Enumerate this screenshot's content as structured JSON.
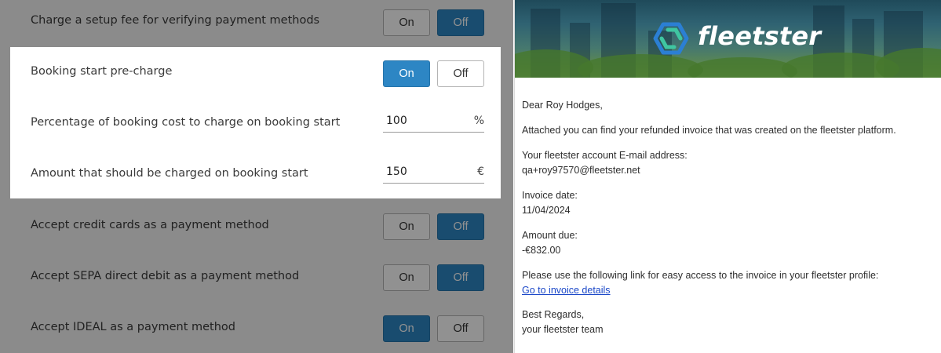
{
  "settings": {
    "on_label": "On",
    "off_label": "Off",
    "rows": [
      {
        "label": "Charge a setup fee for verifying payment methods",
        "state": "off"
      },
      {
        "label": "Booking start pre-charge",
        "state": "on"
      },
      {
        "label": "Percentage of booking cost to charge on booking start",
        "value": "100",
        "unit": "%"
      },
      {
        "label": "Amount that should be charged on booking start",
        "value": "150",
        "unit": "€"
      },
      {
        "label": "Accept credit cards as a payment method",
        "state": "off"
      },
      {
        "label": "Accept SEPA direct debit as a payment method",
        "state": "off"
      },
      {
        "label": "Accept IDEAL as a payment method",
        "state": "on"
      }
    ]
  },
  "email": {
    "brand": "fleetster",
    "greeting": "Dear Roy Hodges,",
    "intro": "Attached you can find your refunded invoice that was created on the fleetster platform.",
    "account_label": "Your fleetster account E-mail address:",
    "account_email": "qa+roy97570@fleetster.net",
    "date_label": "Invoice date:",
    "date_value": "11/04/2024",
    "amount_label": "Amount due:",
    "amount_value": "-€832.00",
    "link_intro": "Please use the following link for easy access to the invoice in your fleetster profile:",
    "link_text": "Go to invoice details",
    "closing": "Best Regards,",
    "signature": "your fleetster team"
  },
  "colors": {
    "accent": "#2d86c4",
    "link": "#1a47c8",
    "logo_green": "#3fc6a1",
    "logo_blue": "#2b7fd4"
  }
}
